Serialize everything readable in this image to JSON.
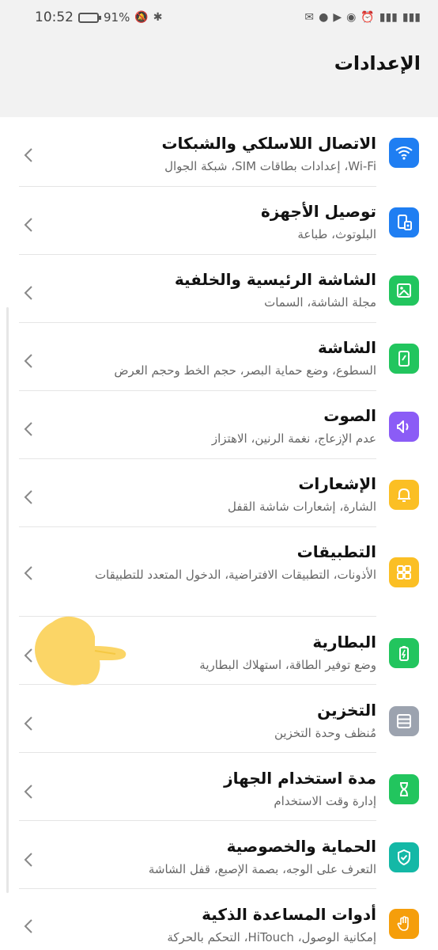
{
  "status_bar": {
    "time": "10:52",
    "battery": "91%"
  },
  "header": {
    "title": "الإعدادات"
  },
  "items": [
    {
      "title": "الاتصال اللاسلكي والشبكات",
      "subtitle": "Wi-Fi، إعدادات بطاقات SIM، شبكة الجوال",
      "icon": "wifi-icon",
      "color": "#1f7ef2"
    },
    {
      "title": "توصيل الأجهزة",
      "subtitle": "البلوتوث، طباعة",
      "icon": "device-connect-icon",
      "color": "#1f7ef2"
    },
    {
      "title": "الشاشة الرئيسية والخلفية",
      "subtitle": "مجلة الشاشة، السمات",
      "icon": "wallpaper-icon",
      "color": "#22c55e"
    },
    {
      "title": "الشاشة",
      "subtitle": "السطوع، وضع حماية البصر، حجم الخط وحجم العرض",
      "icon": "display-icon",
      "color": "#22c55e"
    },
    {
      "title": "الصوت",
      "subtitle": "عدم الإزعاج، نغمة الرنين، الاهتزاز",
      "icon": "sound-icon",
      "color": "#8b5cf6"
    },
    {
      "title": "الإشعارات",
      "subtitle": "الشارة، إشعارات شاشة القفل",
      "icon": "bell-icon",
      "color": "#fbbf24"
    },
    {
      "title": "التطبيقات",
      "subtitle": "الأذونات، التطبيقات الافتراضية، الدخول المتعدد للتطبيقات",
      "icon": "apps-icon",
      "color": "#fbbf24"
    },
    {
      "title": "البطارية",
      "subtitle": "وضع توفير الطاقة، استهلاك البطارية",
      "icon": "battery-icon",
      "color": "#22c55e"
    },
    {
      "title": "التخزين",
      "subtitle": "مُنظف وحدة التخزين",
      "icon": "storage-icon",
      "color": "#9ca3af"
    },
    {
      "title": "مدة استخدام الجهاز",
      "subtitle": "إدارة وقت الاستخدام",
      "icon": "hourglass-icon",
      "color": "#22c55e"
    },
    {
      "title": "الحماية والخصوصية",
      "subtitle": "التعرف على الوجه، بصمة الإصبع، قفل الشاشة",
      "icon": "shield-icon",
      "color": "#14b8a6"
    },
    {
      "title": "أدوات المساعدة الذكية",
      "subtitle": "إمكانية الوصول، HiTouch، التحكم بالحركة",
      "icon": "hand-icon",
      "color": "#f59e0b"
    }
  ]
}
